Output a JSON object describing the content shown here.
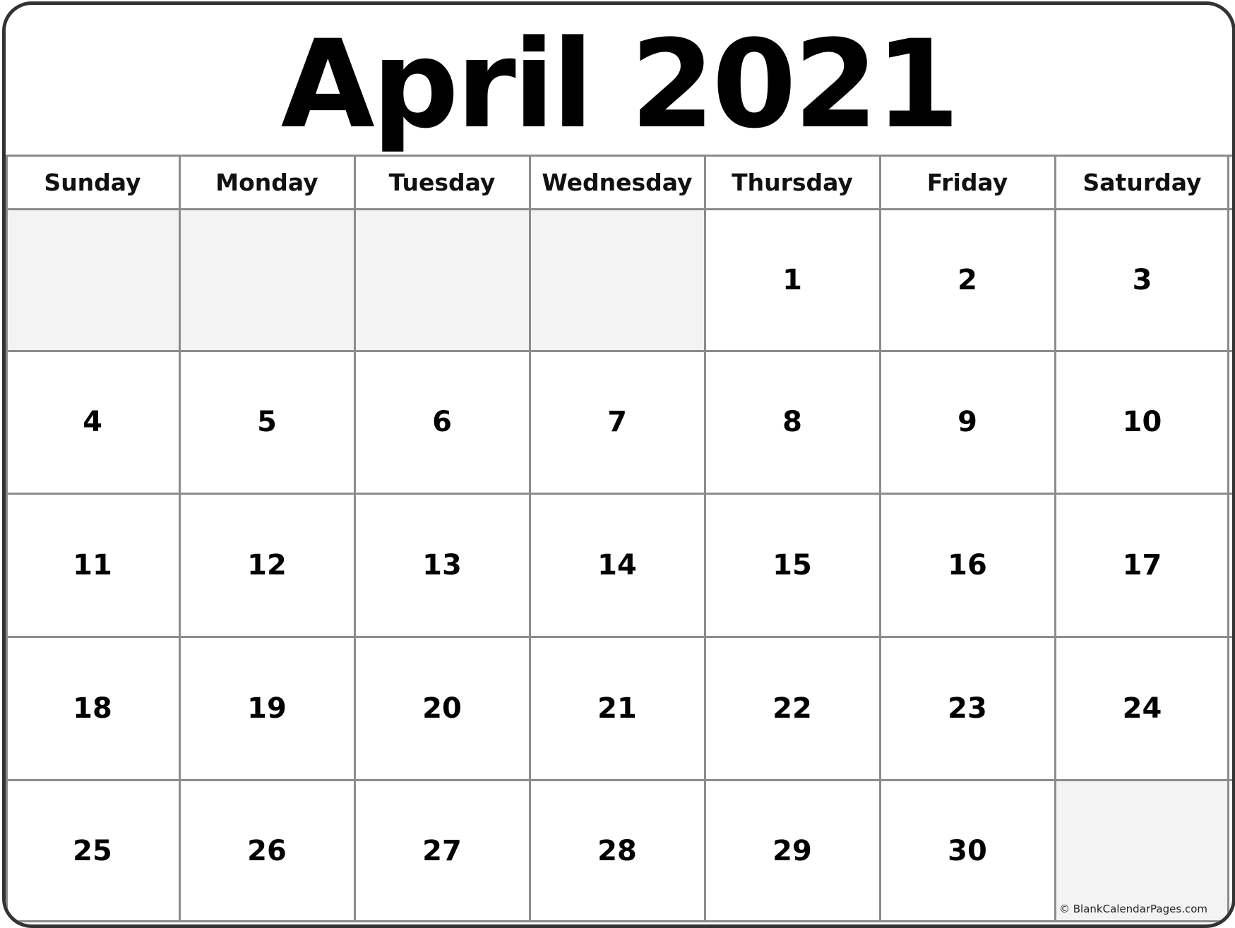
{
  "title": "April 2021",
  "month": "April",
  "year": "2021",
  "weekdays": [
    "Sunday",
    "Monday",
    "Tuesday",
    "Wednesday",
    "Thursday",
    "Friday",
    "Saturday"
  ],
  "weeks": [
    [
      "",
      "",
      "",
      "",
      "1",
      "2",
      "3"
    ],
    [
      "4",
      "5",
      "6",
      "7",
      "8",
      "9",
      "10"
    ],
    [
      "11",
      "12",
      "13",
      "14",
      "15",
      "16",
      "17"
    ],
    [
      "18",
      "19",
      "20",
      "21",
      "22",
      "23",
      "24"
    ],
    [
      "25",
      "26",
      "27",
      "28",
      "29",
      "30",
      ""
    ]
  ],
  "copyright": "© BlankCalendarPages.com",
  "colors": {
    "border": "#333333",
    "grid": "#8c8c8c",
    "empty_cell": "#f3f3f3",
    "text": "#000000"
  }
}
